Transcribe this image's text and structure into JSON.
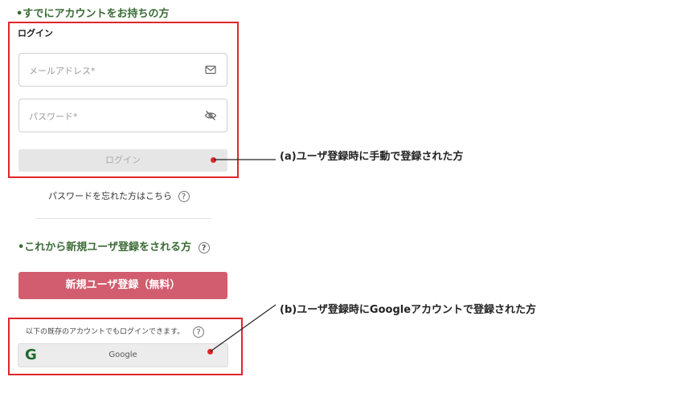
{
  "existing_section": {
    "heading": "•すでにアカウントをお持ちの方",
    "login_title": "ログイン",
    "email_placeholder": "メールアドレス*",
    "password_placeholder": "パスワード*",
    "login_button": "ログイン",
    "forgot_link": "パスワードを忘れた方はこちら"
  },
  "new_section": {
    "heading": "•これから新規ユーザ登録をされる方",
    "register_button": "新規ユーザ登録（無料）"
  },
  "social": {
    "note": "以下の既存のアカウントでもログインできます。",
    "google_logo": "G",
    "google_label": "Google"
  },
  "annotations": {
    "a": "(a)ユーザ登録時に手動で登録された方",
    "b": "(b)ユーザ登録時にGoogleアカウントで登録された方"
  },
  "help_glyph": "?",
  "colors": {
    "highlight_red": "#e0262a",
    "heading_green": "#3a6b35",
    "register_pink": "#d25d6e",
    "google_green": "#1e6b2e"
  },
  "icons": {
    "email_field": "envelope-icon",
    "password_field": "eye-slash-icon",
    "help": "question-circle-icon"
  }
}
